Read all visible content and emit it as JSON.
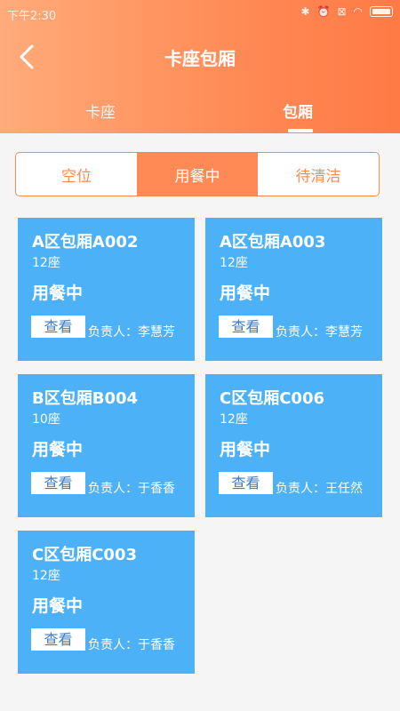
{
  "status_bar": {
    "time": "下午2:30"
  },
  "header": {
    "title": "卡座包厢",
    "tabs": [
      {
        "label": "卡座"
      },
      {
        "label": "包厢"
      }
    ]
  },
  "segment": {
    "options": [
      {
        "label": "空位"
      },
      {
        "label": "用餐中"
      },
      {
        "label": "待清洁"
      }
    ]
  },
  "rooms": [
    {
      "name": "A区包厢A002",
      "seats": "12座",
      "status": "用餐中",
      "button": "查看",
      "manager": "负责人：李慧芳"
    },
    {
      "name": "A区包厢A003",
      "seats": "12座",
      "status": "用餐中",
      "button": "查看",
      "manager": "负责人：李慧芳"
    },
    {
      "name": "B区包厢B004",
      "seats": "10座",
      "status": "用餐中",
      "button": "查看",
      "manager": "负责人：于香香"
    },
    {
      "name": "C区包厢C006",
      "seats": "12座",
      "status": "用餐中",
      "button": "查看",
      "manager": "负责人：王任然"
    },
    {
      "name": "C区包厢C003",
      "seats": "12座",
      "status": "用餐中",
      "button": "查看",
      "manager": "负责人：于香香"
    }
  ],
  "colors": {
    "accent": "#ff8a55",
    "card": "#4db1f8"
  }
}
